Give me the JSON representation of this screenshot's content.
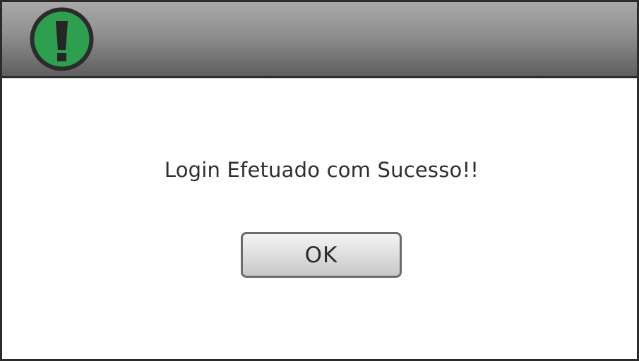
{
  "dialog": {
    "icon": "exclamation-icon",
    "icon_color": "#2e9e4f",
    "message": "Login Efetuado com Sucesso!!",
    "ok_label": "OK"
  }
}
